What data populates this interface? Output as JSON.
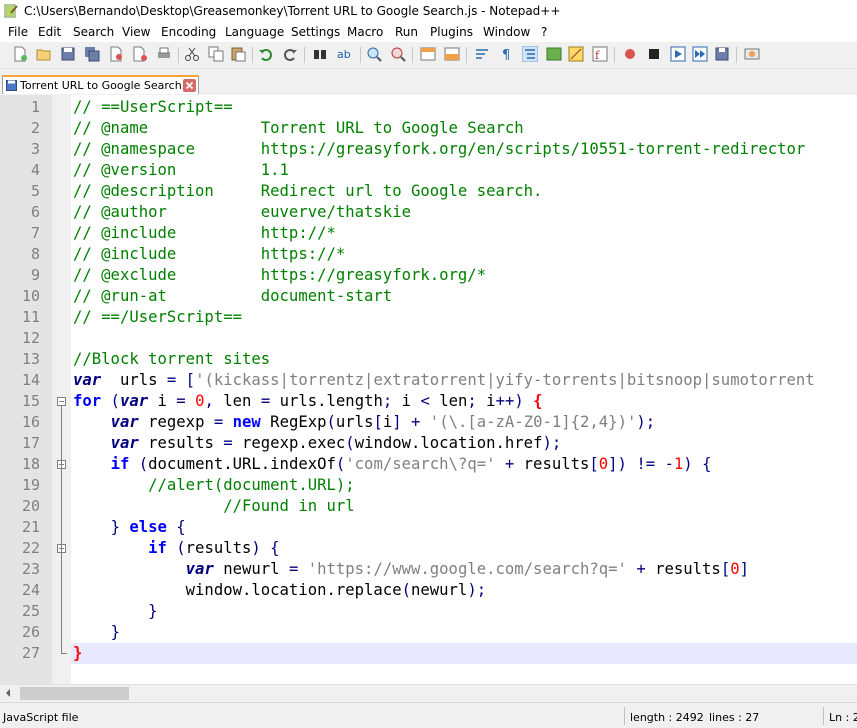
{
  "window": {
    "title": "C:\\Users\\Bernando\\Desktop\\Greasemonkey\\Torrent URL to Google Search.js - Notepad++"
  },
  "menu": [
    "File",
    "Edit",
    "Search",
    "View",
    "Encoding",
    "Language",
    "Settings",
    "Macro",
    "Run",
    "Plugins",
    "Window",
    "?"
  ],
  "tab": {
    "label": "Torrent URL to Google Search.js"
  },
  "editor": {
    "line_numbers": [
      "1",
      "2",
      "3",
      "4",
      "5",
      "6",
      "7",
      "8",
      "9",
      "10",
      "11",
      "12",
      "13",
      "14",
      "15",
      "16",
      "17",
      "18",
      "19",
      "20",
      "21",
      "22",
      "23",
      "24",
      "25",
      "26",
      "27"
    ],
    "lines": [
      [
        [
          "cm",
          "// ==UserScript=="
        ]
      ],
      [
        [
          "cm",
          "// @name            Torrent URL to Google Search"
        ]
      ],
      [
        [
          "cm",
          "// @namespace       https://greasyfork.org/en/scripts/10551-torrent-redirector"
        ]
      ],
      [
        [
          "cm",
          "// @version         1.1"
        ]
      ],
      [
        [
          "cm",
          "// @description     Redirect url to Google search."
        ]
      ],
      [
        [
          "cm",
          "// @author          euverve/thatskie"
        ]
      ],
      [
        [
          "cm",
          "// @include         http://*"
        ]
      ],
      [
        [
          "cm",
          "// @include         https://*"
        ]
      ],
      [
        [
          "cm",
          "// @exclude         https://greasyfork.org/*"
        ]
      ],
      [
        [
          "cm",
          "// @run-at          document-start"
        ]
      ],
      [
        [
          "cm",
          "// ==/UserScript=="
        ]
      ],
      [],
      [
        [
          "cm",
          "//Block torrent sites"
        ]
      ],
      [
        [
          "kw2",
          "var"
        ],
        [
          "",
          "  urls "
        ],
        [
          "op",
          "="
        ],
        [
          "",
          ""
        ],
        [
          "punct",
          " ["
        ],
        [
          "str",
          "'(kickass|torrentz|extratorrent|yify-torrents|bitsnoop|sumotorrent"
        ]
      ],
      [
        [
          "kw",
          "for"
        ],
        [
          "punct",
          " ("
        ],
        [
          "kw2",
          "var"
        ],
        [
          "",
          " i "
        ],
        [
          "op",
          "="
        ],
        [
          "num",
          " 0"
        ],
        [
          "punct",
          ","
        ],
        [
          "",
          " len "
        ],
        [
          "op",
          "="
        ],
        [
          "",
          " urls.length"
        ],
        [
          "punct",
          ";"
        ],
        [
          "",
          " i "
        ],
        [
          "op",
          "<"
        ],
        [
          "",
          " len"
        ],
        [
          "punct",
          ";"
        ],
        [
          "",
          " i"
        ],
        [
          "op",
          "++"
        ],
        [
          "punct",
          ") "
        ],
        [
          "brace",
          "{"
        ]
      ],
      [
        [
          "",
          "    "
        ],
        [
          "kw2",
          "var"
        ],
        [
          "",
          " regexp "
        ],
        [
          "op",
          "="
        ],
        [
          " ",
          ""
        ],
        [
          "kw",
          " new"
        ],
        [
          "",
          " RegExp"
        ],
        [
          "punct",
          "("
        ],
        [
          "",
          "urls"
        ],
        [
          "punct",
          "["
        ],
        [
          "",
          "i"
        ],
        [
          "punct",
          "]"
        ],
        [
          "op",
          " +"
        ],
        [
          "str",
          " '(\\.[a-zA-Z0-1]{2,4})'"
        ],
        [
          "punct",
          ");"
        ]
      ],
      [
        [
          "",
          "    "
        ],
        [
          "kw2",
          "var"
        ],
        [
          "",
          " results "
        ],
        [
          "op",
          "="
        ],
        [
          "",
          " regexp.exec"
        ],
        [
          "punct",
          "("
        ],
        [
          "",
          "window.location.href"
        ],
        [
          "punct",
          ");"
        ]
      ],
      [
        [
          "",
          "    "
        ],
        [
          "kw",
          "if"
        ],
        [
          "punct",
          " ("
        ],
        [
          "",
          "document.URL.indexOf"
        ],
        [
          "punct",
          "("
        ],
        [
          "str",
          "'com/search\\?q='"
        ],
        [
          "op",
          " +"
        ],
        [
          "",
          " results"
        ],
        [
          "punct",
          "["
        ],
        [
          "num",
          "0"
        ],
        [
          "punct",
          "])"
        ],
        [
          "op",
          " !="
        ],
        [
          "op",
          " -"
        ],
        [
          "num",
          "1"
        ],
        [
          "punct",
          ") {"
        ]
      ],
      [
        [
          "",
          "        "
        ],
        [
          "cm",
          "//alert(document.URL);"
        ]
      ],
      [
        [
          "",
          "                "
        ],
        [
          "cm",
          "//Found in url"
        ]
      ],
      [
        [
          "",
          "    "
        ],
        [
          "punct",
          "}"
        ],
        [
          "kw",
          " else"
        ],
        [
          "punct",
          " {"
        ]
      ],
      [
        [
          "",
          "        "
        ],
        [
          "kw",
          "if"
        ],
        [
          "punct",
          " ("
        ],
        [
          "",
          "results"
        ],
        [
          "punct",
          ") {"
        ]
      ],
      [
        [
          "",
          "            "
        ],
        [
          "kw2",
          "var"
        ],
        [
          "",
          " newurl "
        ],
        [
          "op",
          "="
        ],
        [
          "str",
          " 'https://www.google.com/search?q='"
        ],
        [
          "op",
          " +"
        ],
        [
          "",
          " results"
        ],
        [
          "punct",
          "["
        ],
        [
          "num",
          "0"
        ],
        [
          "punct",
          "]"
        ]
      ],
      [
        [
          "",
          "            window.location.replace"
        ],
        [
          "punct",
          "("
        ],
        [
          "",
          "newurl"
        ],
        [
          "punct",
          ");"
        ]
      ],
      [
        [
          "",
          "        "
        ],
        [
          "punct",
          "}"
        ]
      ],
      [
        [
          "",
          "    "
        ],
        [
          "punct",
          "}"
        ]
      ],
      [
        [
          "brace",
          "}"
        ]
      ]
    ]
  },
  "status": {
    "filetype": "JavaScript file",
    "length": "length : 2492",
    "lines": "lines : 27",
    "ln": "Ln : 2"
  }
}
